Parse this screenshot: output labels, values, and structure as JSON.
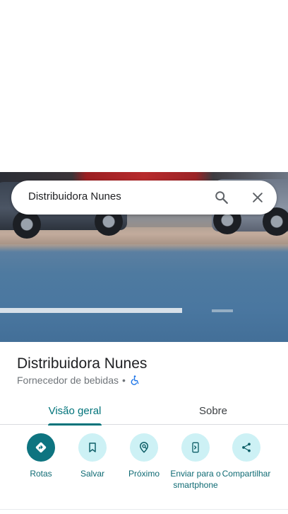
{
  "search": {
    "query": "Distribuidora Nunes"
  },
  "place": {
    "name": "Distribuidora Nunes",
    "category": "Fornecedor de bebidas",
    "separator": "•"
  },
  "tabs": [
    {
      "label": "Visão geral",
      "selected": true
    },
    {
      "label": "Sobre",
      "selected": false
    }
  ],
  "actions": [
    {
      "label": "Rotas",
      "icon": "directions-icon"
    },
    {
      "label": "Salvar",
      "icon": "bookmark-icon"
    },
    {
      "label": "Próximo",
      "icon": "nearby-icon"
    },
    {
      "label": "Enviar para o smartphone",
      "icon": "send-to-phone-icon"
    },
    {
      "label": "Compartilhar",
      "icon": "share-icon"
    }
  ],
  "colors": {
    "accent": "#00737a",
    "action_bg": "#cdf1f5",
    "action_primary_bg": "#0e7480",
    "accessibility_icon": "#1a73e8"
  }
}
